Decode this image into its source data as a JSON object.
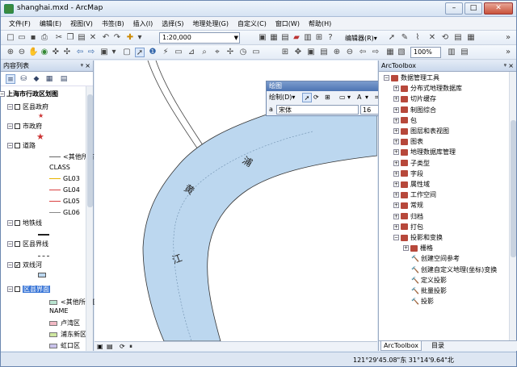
{
  "window": {
    "title": "shanghai.mxd - ArcMap",
    "min": "–",
    "max": "□",
    "close": "✕"
  },
  "menu": [
    "文件(F)",
    "编辑(E)",
    "视图(V)",
    "书签(B)",
    "插入(I)",
    "选择(S)",
    "地理处理(G)",
    "自定义(C)",
    "窗口(W)",
    "帮助(H)"
  ],
  "toolbar": {
    "scale": "1:20,000",
    "editor_label": "编辑器(R)▾",
    "zoom": "100%"
  },
  "toc": {
    "title": "内容列表",
    "items": [
      {
        "text": "上海市行政区划图",
        "indent": 8,
        "bold": true,
        "expander": "⊟"
      },
      {
        "text": "区县政府",
        "indent": 18,
        "expander": "⊟",
        "check": ""
      },
      {
        "text": "市政府",
        "indent": 18,
        "expander": "⊟",
        "check": ""
      },
      {
        "text": "道路",
        "indent": 18,
        "expander": "⊟",
        "check": ""
      },
      {
        "text": "<其他所有值>",
        "indent": 60
      },
      {
        "text": "CLASS",
        "indent": 60
      },
      {
        "text": "GL03",
        "indent": 60
      },
      {
        "text": "GL04",
        "indent": 60
      },
      {
        "text": "GL05",
        "indent": 60
      },
      {
        "text": "GL06",
        "indent": 60
      },
      {
        "text": "地铁线",
        "indent": 18,
        "expander": "⊟",
        "check": ""
      },
      {
        "text": "区县界线",
        "indent": 18,
        "expander": "⊟",
        "check": ""
      },
      {
        "text": "双线河",
        "indent": 18,
        "expander": "⊟",
        "check": "✓"
      },
      {
        "text": "区县界面",
        "indent": 18,
        "expander": "⊟",
        "check": "",
        "selected": true
      },
      {
        "text": "<其他所有值>",
        "indent": 60
      },
      {
        "text": "NAME",
        "indent": 60
      },
      {
        "text": "卢湾区",
        "indent": 60
      },
      {
        "text": "浦东新区",
        "indent": 60
      },
      {
        "text": "虹口区",
        "indent": 60
      }
    ]
  },
  "drawing": {
    "title": "绘图",
    "draw_menu": "绘制(D)▾",
    "font": "宋体",
    "size": "16",
    "bold": "B",
    "italic": "I",
    "underline": "U",
    "font_color": "A",
    "close": "✕"
  },
  "map": {
    "labels": [
      "黄",
      "浦",
      "江"
    ]
  },
  "arctoolbox": {
    "title": "ArcToolbox",
    "items": [
      {
        "text": "数据管理工具",
        "indent": 6,
        "expander": "⊟",
        "type": "toolbox"
      },
      {
        "text": "分布式地理数据库",
        "indent": 18,
        "expander": "⊞",
        "type": "toolbox"
      },
      {
        "text": "切片缓存",
        "indent": 18,
        "expander": "⊞",
        "type": "toolbox"
      },
      {
        "text": "制图综合",
        "indent": 18,
        "expander": "⊞",
        "type": "toolbox"
      },
      {
        "text": "包",
        "indent": 18,
        "expander": "⊞",
        "type": "toolbox"
      },
      {
        "text": "图层和表视图",
        "indent": 18,
        "expander": "⊞",
        "type": "toolbox"
      },
      {
        "text": "图表",
        "indent": 18,
        "expander": "⊞",
        "type": "toolbox"
      },
      {
        "text": "地理数据库管理",
        "indent": 18,
        "expander": "⊞",
        "type": "toolbox"
      },
      {
        "text": "子类型",
        "indent": 18,
        "expander": "⊞",
        "type": "toolbox"
      },
      {
        "text": "字段",
        "indent": 18,
        "expander": "⊞",
        "type": "toolbox"
      },
      {
        "text": "属性域",
        "indent": 18,
        "expander": "⊞",
        "type": "toolbox"
      },
      {
        "text": "工作空间",
        "indent": 18,
        "expander": "⊞",
        "type": "toolbox"
      },
      {
        "text": "常规",
        "indent": 18,
        "expander": "⊞",
        "type": "toolbox"
      },
      {
        "text": "归档",
        "indent": 18,
        "expander": "⊞",
        "type": "toolbox"
      },
      {
        "text": "打包",
        "indent": 18,
        "expander": "⊞",
        "type": "toolbox"
      },
      {
        "text": "投影和变换",
        "indent": 18,
        "expander": "⊟",
        "type": "toolbox"
      },
      {
        "text": "栅格",
        "indent": 30,
        "expander": "⊞",
        "type": "toolbox"
      },
      {
        "text": "创建空间参考",
        "indent": 40,
        "type": "tool"
      },
      {
        "text": "创建自定义地理(坐标)变换",
        "indent": 40,
        "type": "tool"
      },
      {
        "text": "定义投影",
        "indent": 40,
        "type": "tool"
      },
      {
        "text": "批量投影",
        "indent": 40,
        "type": "tool"
      },
      {
        "text": "投影",
        "indent": 40,
        "type": "tool"
      }
    ],
    "tabs": [
      "ArcToolbox",
      "目录"
    ]
  },
  "status": {
    "coords": "121°29'45.08\"东  31°14'9.64\"北"
  }
}
